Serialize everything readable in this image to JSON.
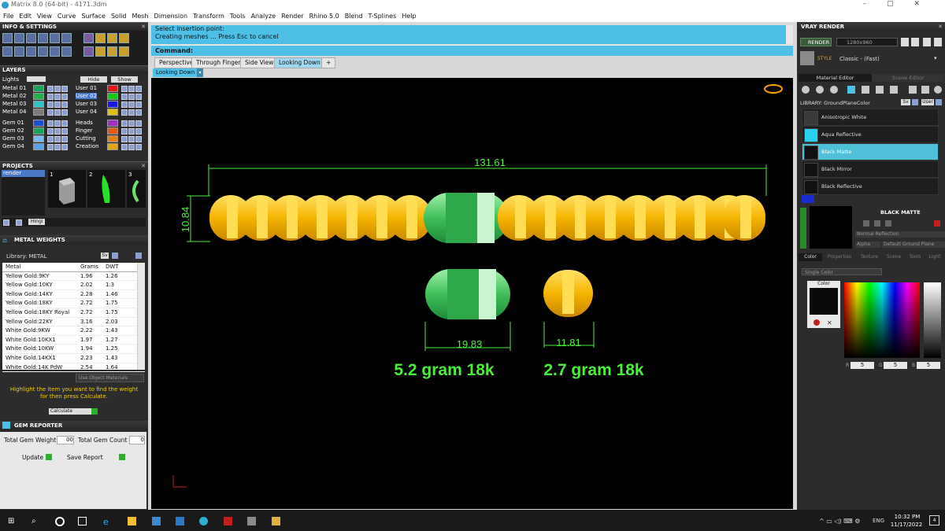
{
  "window": {
    "title": "Matrix 8.0 (64-bit) - 4171.3dm"
  },
  "menu": [
    "File",
    "Edit",
    "View",
    "Curve",
    "Surface",
    "Solid",
    "Mesh",
    "Dimension",
    "Transform",
    "Tools",
    "Analyze",
    "Render",
    "Rhino 5.0",
    "Blend",
    "T-Splines",
    "Help"
  ],
  "panels": {
    "info": "INFO & SETTINGS",
    "layers": "LAYERS",
    "projects": "PROJECTS",
    "metal_weights": "METAL WEIGHTS",
    "gem_reporter": "GEM REPORTER"
  },
  "layers": {
    "lights": "Lights",
    "hide": "Hide",
    "show": "Show",
    "left": [
      "Metal 01",
      "Metal 02",
      "Metal 03",
      "Metal 04",
      "Gem 01",
      "Gem 02",
      "Gem 03",
      "Gem 04"
    ],
    "right": [
      "User 01",
      "User 02",
      "User 03",
      "User 04",
      "Heads",
      "Finger",
      "Cutting",
      "Creation"
    ],
    "left_colors": [
      "#1aa35a",
      "#23b04f",
      "#2fc3c8",
      "#7c7c7c",
      "#1e50d0",
      "#1aa35a",
      "#7abaf0",
      "#5aa0e6"
    ],
    "right_colors": [
      "#e01818",
      "#18c818",
      "#1818e0",
      "#e0c018",
      "#a030c0",
      "#e05a18",
      "#e08018",
      "#e0a818"
    ]
  },
  "projects": {
    "item": "render",
    "thumbs": [
      "1",
      "2",
      "3"
    ],
    "hinge": "Hingi"
  },
  "metal": {
    "library": "Library: METAL",
    "sv": "Sv",
    "headers": [
      "Metal",
      "Grams",
      "DWT"
    ],
    "rows": [
      [
        "Yellow Gold:9KY",
        "1.96",
        "1.26"
      ],
      [
        "Yellow Gold:10KY",
        "2.02",
        "1.3"
      ],
      [
        "Yellow Gold:14KY",
        "2.28",
        "1.46"
      ],
      [
        "Yellow Gold:18KY",
        "2.72",
        "1.75"
      ],
      [
        "Yellow Gold:18KY Royal",
        "2.72",
        "1.75"
      ],
      [
        "Yellow Gold:22KY",
        "3.16",
        "2.03"
      ],
      [
        "White Gold:9KW",
        "2.22",
        "1.43"
      ],
      [
        "White Gold:10KX1",
        "1.97",
        "1.27"
      ],
      [
        "White Gold:10KW",
        "1.94",
        "1.25"
      ],
      [
        "White Gold:14KX1",
        "2.23",
        "1.43"
      ],
      [
        "White Gold:14K PdW",
        "2.54",
        "1.64"
      ]
    ],
    "use_object": "Use Object Materials",
    "hint": "Highlight the item you want to find the weight for then press Calculate.",
    "calculate": "Calculate"
  },
  "gem": {
    "total_weight_label": "Total Gem Weight",
    "total_weight": "00",
    "total_count_label": "Total Gem Count",
    "total_count": "0",
    "update": "Update",
    "save": "Save Report"
  },
  "command": {
    "line1": "Select insertion point:",
    "line2": "Creating meshes ... Press Esc to cancel",
    "label": "Command:"
  },
  "tabs": [
    "Perspective",
    "Through Finger",
    "Side View",
    "Looking Down"
  ],
  "viewport": {
    "label": "Looking Down",
    "dims": {
      "length": "131.61",
      "height": "10.84",
      "clasp_width": "19.83",
      "link_width": "11.81"
    },
    "captions": {
      "clasp": "5.2 gram 18k",
      "link": "2.7 gram 18k"
    }
  },
  "vray": {
    "title": "VRAY RENDER",
    "render": "RENDER",
    "resolution": "1280x960",
    "style_label": "STYLE",
    "style": "Classic - (Fast)",
    "tabs": [
      "Material Editor",
      "Scene Editor"
    ],
    "library": "LIBRARY: GroundPlaneColor",
    "sv": "Sv",
    "user": "User",
    "materials": [
      "Anisotropic White",
      "Aqua Reflective",
      "Black Matte",
      "Black Mirror",
      "Black Reflective"
    ],
    "material_colors": [
      "#3a3a3a",
      "#2ad0f0",
      "#0a0a0a",
      "#0a0a0a",
      "#0a0a0a"
    ],
    "selected": "BLACK MATTE",
    "reflection": "Normal Reflection",
    "alpha": "Alpha",
    "ground": "Default Ground Plane",
    "subtabs": [
      "Color",
      "Properties",
      "Texture",
      "Scene",
      "Tools",
      "Light"
    ],
    "color_mode": "Single Color",
    "color_label": "Color",
    "rgb": [
      "5",
      "5",
      "5"
    ]
  },
  "taskbar": {
    "lang": "ENG",
    "time": "10:32 PM",
    "date": "11/17/2022",
    "notif": "4"
  }
}
